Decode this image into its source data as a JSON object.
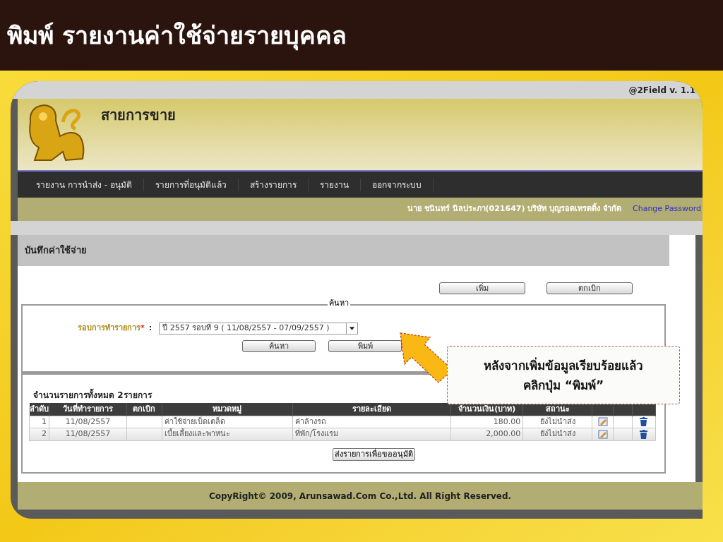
{
  "slide_title": "พิมพ์ รายงานค่าใช้จ่ายรายบุคคล",
  "app": {
    "version": "@2Field v. 1.1",
    "header_title": "สายการขาย",
    "nav": [
      {
        "label": "รายงาน การนำส่ง - อนุมัติ"
      },
      {
        "label": "รายการที่อนุมัติแล้ว"
      },
      {
        "label": "สร้างรายการ"
      },
      {
        "label": "รายงาน"
      },
      {
        "label": "ออกจากระบบ"
      }
    ],
    "user_info": "นาย ชนินทร์ นิลประภา(021647) บริษัท บุญรอดเทรดดิ้ง จำกัด",
    "change_password": "Change Password",
    "section_title": "บันทึกค่าใช้จ่าย",
    "top_buttons": [
      "เพิ่ม",
      "ตกเบิก"
    ],
    "search": {
      "legend": "ค้นหา",
      "field_label": "รอบการทำรายการ",
      "required": "*",
      "separator": ":",
      "value": "ปี 2557 รอบที่ 9 ( 11/08/2557 - 07/09/2557 )",
      "buttons": [
        "ค้นหา",
        "พิมพ์"
      ]
    },
    "count_text": "จำนวนรายการทั้งหมด 2รายการ",
    "table": {
      "columns": [
        "ลำดับ",
        "วันที่ทำรายการ",
        "ตกเบิก",
        "หมวดหมู่",
        "รายละเอียด",
        "จำนวนเงิน(บาท)",
        "สถานะ"
      ],
      "rows": [
        {
          "no": "1",
          "date": "11/08/2557",
          "category": "ค่าใช้จ่ายเบ็ดเตล็ด",
          "detail": "ค่าล้างรถ",
          "amount": "180.00",
          "status": "ยังไม่นำส่ง"
        },
        {
          "no": "2",
          "date": "11/08/2557",
          "category": "เบี้ยเลี้ยงและพาหนะ",
          "detail": "ที่พัก/โรงแรม",
          "amount": "2,000.00",
          "status": "ยังไม่นำส่ง"
        }
      ]
    },
    "submit_button": "ส่งรายการเพื่อขออนุมัติ",
    "footer": "CopyRight© 2009, Arunsawad.Com Co.,Ltd. All Right Reserved."
  },
  "callout": [
    "หลังจากเพิ่มข้อมูลเรียบร้อยแล้ว",
    "คลิกปุ่ม “พิมพ์”"
  ]
}
